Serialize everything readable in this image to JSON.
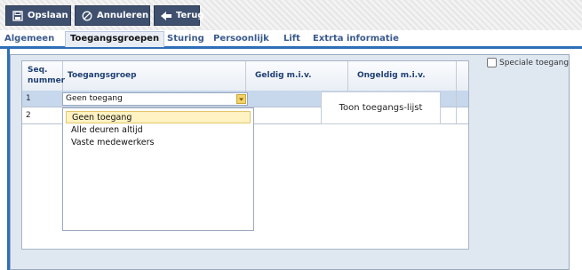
{
  "toolbar": {
    "save_label": "Opslaan",
    "cancel_label": "Annuleren",
    "back_label": "Terug"
  },
  "tabs": [
    {
      "label": "Algemeen"
    },
    {
      "label": "Toegangsgroepen"
    },
    {
      "label": "Sturing"
    },
    {
      "label": "Persoonlijk"
    },
    {
      "label": "Lift"
    },
    {
      "label": "Extrta informatie"
    }
  ],
  "active_tab": "Toegangsgroepen",
  "special_access_label": "Speciale toegang",
  "special_access_checked": false,
  "grid": {
    "columns": [
      {
        "label_line1": "Seq.",
        "label_line2": "nummer"
      },
      {
        "label_line1": "Toegangsgroep",
        "label_line2": ""
      },
      {
        "label_line1": "Geldig m.i.v.",
        "label_line2": ""
      },
      {
        "label_line1": "Ongeldig m.i.v.",
        "label_line2": ""
      }
    ],
    "rows": [
      {
        "seq": "1",
        "group": "Geen toegang",
        "valid_from": "",
        "valid_until": ""
      },
      {
        "seq": "2",
        "group": "",
        "valid_from": "",
        "valid_until": ""
      }
    ]
  },
  "dropdown": {
    "selected": "Geen toegang",
    "options": [
      "Geen toegang",
      "Alle deuren altijd",
      "Vaste medewerkers"
    ]
  },
  "toon_button_label": "Toon toegangs-lijst",
  "colors": {
    "toolbar_button": "#3f4f6e",
    "tab_underline": "#2f6fb8",
    "panel": "#dfe7f1",
    "selected_row": "#c7d7ec",
    "highlight_option": "#fff2c3"
  }
}
